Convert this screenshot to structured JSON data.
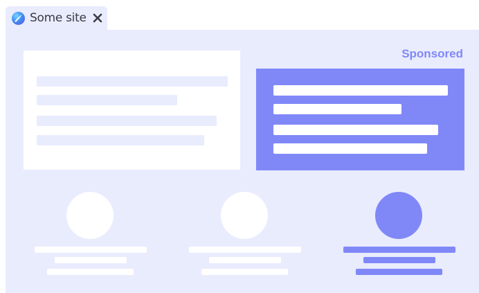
{
  "tab": {
    "title": "Some site",
    "favicon": "site-favicon-icon",
    "close_icon": "close-icon"
  },
  "ad": {
    "label": "Sponsored",
    "accent_color": "#8088f8"
  },
  "colors": {
    "page_background": "#e9ecfd",
    "card_background": "#ffffff",
    "accent": "#8088f8"
  }
}
